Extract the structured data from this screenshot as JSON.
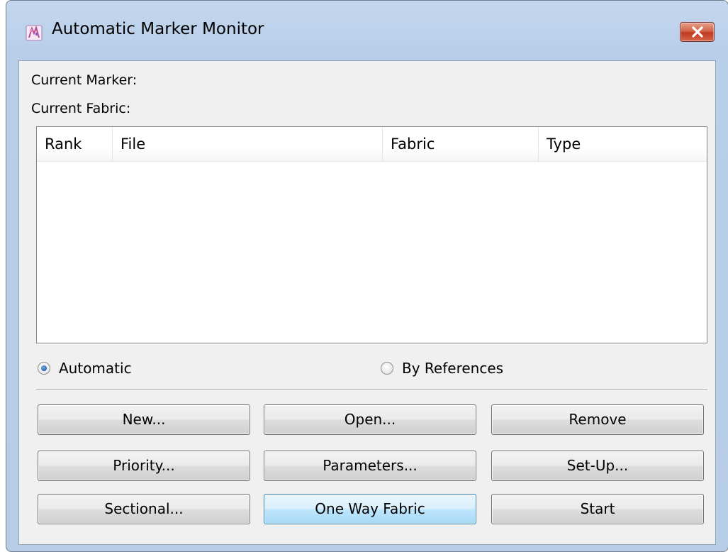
{
  "window": {
    "title": "Automatic Marker Monitor"
  },
  "info": {
    "current_marker_label": "Current Marker:",
    "current_fabric_label": "Current Fabric:"
  },
  "table": {
    "columns": [
      "Rank",
      "File",
      "Fabric",
      "Type"
    ],
    "rows": []
  },
  "mode": {
    "options": [
      {
        "label": "Automatic",
        "selected": true
      },
      {
        "label": "By References",
        "selected": false
      }
    ]
  },
  "buttons": {
    "new": "New...",
    "open": "Open...",
    "remove": "Remove",
    "priority": "Priority...",
    "parameters": "Parameters...",
    "setup": "Set-Up...",
    "sectional": "Sectional...",
    "one_way_fabric": "One Way Fabric",
    "start": "Start"
  },
  "colors": {
    "title_bar": "#c3d7ee",
    "client_bg": "#f0f0f0",
    "close_button": "#c94a30",
    "default_button": "#bee6fd"
  },
  "icons": {
    "app": "app-fabric-icon",
    "close": "close-icon",
    "radio_selected": "radio-selected-icon",
    "radio_unselected": "radio-unselected-icon"
  }
}
